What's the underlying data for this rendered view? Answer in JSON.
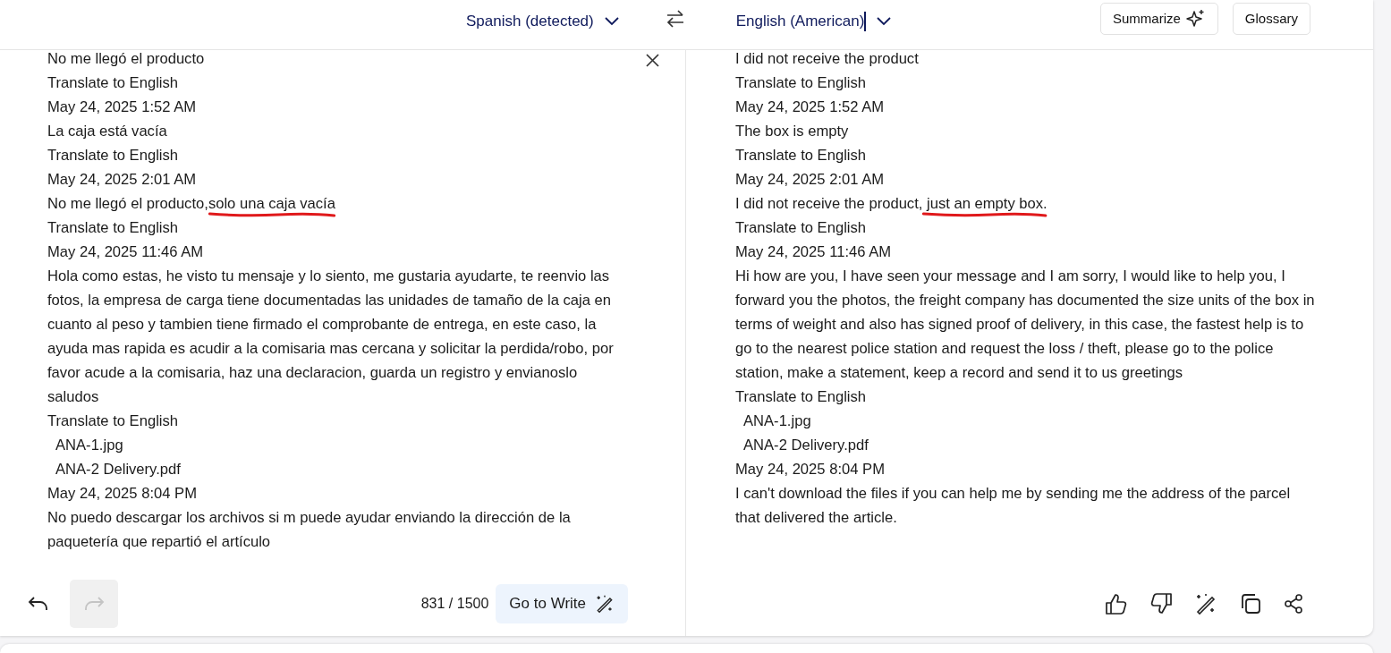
{
  "header": {
    "source_language": {
      "name": "Spanish",
      "note": "(detected)"
    },
    "target_language": {
      "name": "English (American)"
    },
    "buttons": [
      "Summarize",
      "Glossary"
    ]
  },
  "source": {
    "lines": [
      {
        "kind": "text",
        "text": "No me llegó el producto"
      },
      {
        "kind": "text",
        "text": "Translate to English"
      },
      {
        "kind": "text",
        "text": "May 24, 2025 1:52 AM"
      },
      {
        "kind": "text",
        "text": "La caja está vacía"
      },
      {
        "kind": "text",
        "text": "Translate to English"
      },
      {
        "kind": "text",
        "text": "May 24, 2025 2:01 AM"
      },
      {
        "kind": "text",
        "text": "No me llegó el producto,",
        "underlined": "solo una caja vacía"
      },
      {
        "kind": "text",
        "text": "Translate to English"
      },
      {
        "kind": "text",
        "text": "May 24, 2025 11:46 AM"
      },
      {
        "kind": "text",
        "text": "Hola como estas, he visto tu mensaje y lo siento, me gustaria ayudarte, te reenvio las fotos, la empresa de carga tiene documentadas las unidades de tamaño de la caja en cuanto al peso y tambien tiene firmado el comprobante de entrega, en este caso, la ayuda mas rapida es acudir a la comisaria mas cercana y solicitar la perdida/robo, por favor acude a la comisaria, haz una declaracion, guarda un registro y envianoslo saludos"
      },
      {
        "kind": "text",
        "text": "Translate to English"
      },
      {
        "kind": "attachment",
        "text": "ANA-1.jpg"
      },
      {
        "kind": "attachment",
        "text": "ANA-2 Delivery.pdf"
      },
      {
        "kind": "text",
        "text": "May 24, 2025 8:04 PM"
      },
      {
        "kind": "text",
        "text": "No puedo descargar los archivos si m puede ayudar enviando la dirección de la paquetería que repartió el artículo"
      }
    ],
    "undo": {
      "disabled": false
    },
    "redo": {
      "disabled": true
    },
    "char_count": "831 / 1500",
    "write_button": "Go to Write"
  },
  "target": {
    "lines": [
      {
        "kind": "text",
        "text": "I did not receive the product"
      },
      {
        "kind": "text",
        "text": "Translate to English"
      },
      {
        "kind": "text",
        "text": "May 24, 2025 1:52 AM"
      },
      {
        "kind": "text",
        "text": "The box is empty"
      },
      {
        "kind": "text",
        "text": "Translate to English"
      },
      {
        "kind": "text",
        "text": "May 24, 2025 2:01 AM"
      },
      {
        "kind": "text",
        "text": "I did not receive the product,",
        "underlined": " just an empty box."
      },
      {
        "kind": "text",
        "text": "Translate to English"
      },
      {
        "kind": "text",
        "text": "May 24, 2025 11:46 AM"
      },
      {
        "kind": "text",
        "text": "Hi how are you, I have seen your message and I am sorry, I would like to help you, I forward you the photos, the freight company has documented the size units of the box in terms of weight and also has signed proof of delivery, in this case, the fastest help is to go to the nearest police station and request the loss / theft, please go to the police station, make a statement, keep a record and send it to us greetings"
      },
      {
        "kind": "text",
        "text": "Translate to English"
      },
      {
        "kind": "attachment",
        "text": "ANA-1.jpg"
      },
      {
        "kind": "attachment",
        "text": "ANA-2 Delivery.pdf"
      },
      {
        "kind": "text",
        "text": "May 24, 2025 8:04 PM"
      },
      {
        "kind": "text",
        "text": "I can't download the files if you can help me by sending me the address of the parcel that delivered the article."
      }
    ]
  }
}
